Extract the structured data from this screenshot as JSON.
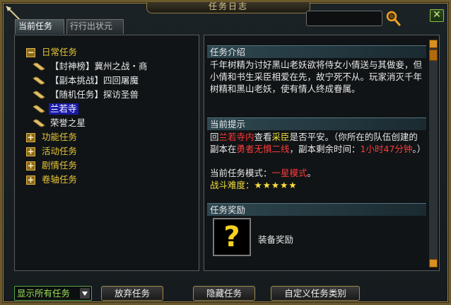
{
  "window": {
    "title": "任务日志"
  },
  "tabs": [
    {
      "label": "当前任务",
      "active": true
    },
    {
      "label": "行行出状元",
      "active": false
    }
  ],
  "search": {
    "value": "",
    "placeholder": ""
  },
  "tree": {
    "categories": [
      {
        "label": "日常任务",
        "expanded": true
      },
      {
        "label": "功能任务",
        "expanded": false
      },
      {
        "label": "活动任务",
        "expanded": false
      },
      {
        "label": "剧情任务",
        "expanded": false
      },
      {
        "label": "卷轴任务",
        "expanded": false
      }
    ],
    "daily_items": [
      {
        "label": "【封神榜】冀州之战・商"
      },
      {
        "label": "【副本挑战】四回屠魔"
      },
      {
        "label": "【随机任务】探访圣兽"
      },
      {
        "label": "兰若寺",
        "selected": true
      },
      {
        "label": "荣誉之星"
      }
    ]
  },
  "intro": {
    "header": "任务介绍",
    "text": "千年树精为讨好黑山老妖欲将侍女小倩送与其做妾，但小倩和书生采臣相爱在先，故宁死不从。玩家消灭千年树精和黑山老妖，使有情人终成眷属。"
  },
  "hint": {
    "header": "当前提示",
    "p1_a": "回",
    "p1_place": "兰若寺内",
    "p1_b": "查看",
    "p1_person": "采臣",
    "p1_c": "是否平安。（你所在的队伍创建的副本在",
    "p1_mode": "勇者无惧二线",
    "p1_d": "，副本剩余时间：",
    "p1_time": "1小时47分钟",
    "p1_e": "。）",
    "p2_a": "当前任务模式：",
    "p2_mode": "一星模式",
    "p2_b": "。",
    "difficulty_label": "战斗难度：",
    "difficulty_stars": "★★★★★"
  },
  "reward": {
    "header": "任务奖励",
    "icon": "question-mark-icon",
    "label": "装备奖励"
  },
  "bottom": {
    "show_all": "显示所有任务",
    "abandon": "放弃任务",
    "hide": "隐藏任务",
    "custom": "自定义任务类别"
  },
  "colors": {
    "category": "#e6c437",
    "highlight_red": "#ff3a3a",
    "highlight_yellow": "#f0dc3c",
    "selected_bg": "#1a1aa8",
    "frame_gold": "#9b8446"
  }
}
